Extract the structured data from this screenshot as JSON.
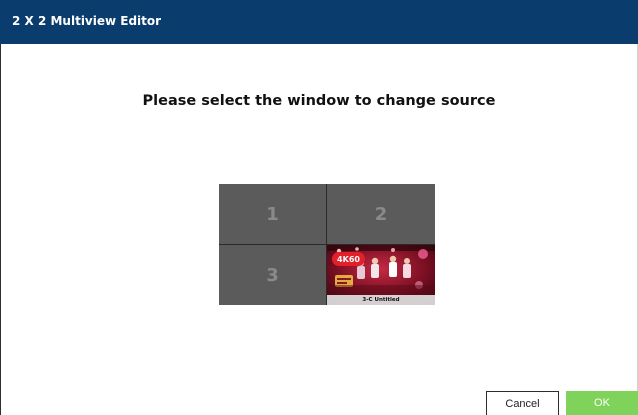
{
  "window": {
    "title": "2 X 2 Multiview Editor"
  },
  "prompt": "Please select the window to change source",
  "grid": {
    "cells": [
      {
        "label": "1"
      },
      {
        "label": "2"
      },
      {
        "label": "3"
      },
      {
        "label": "",
        "badge": "4K60",
        "caption": "3-C Untitled"
      }
    ]
  },
  "buttons": {
    "cancel": "Cancel",
    "ok": "OK"
  },
  "colors": {
    "titlebar": "#0a3c6e",
    "cell": "#5b5b5b",
    "badge": "#e3202a",
    "ok": "#7fd35a"
  }
}
